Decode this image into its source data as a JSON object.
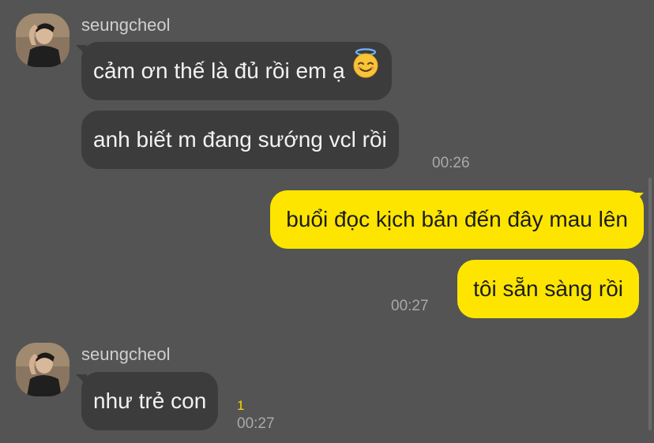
{
  "conversation": {
    "messages": [
      {
        "sender": "seungcheol",
        "text": "cảm ơn thế là đủ rồi em ạ",
        "emoji": "smiling-face-with-halo",
        "direction": "incoming"
      },
      {
        "text": "anh biết m đang sướng vcl rồi",
        "time": "00:26",
        "direction": "incoming"
      },
      {
        "text": "buổi đọc kịch bản đến đây mau lên",
        "direction": "outgoing"
      },
      {
        "text": "tôi sẵn sàng rồi",
        "time": "00:27",
        "direction": "outgoing"
      },
      {
        "sender": "seungcheol",
        "text": "như trẻ con",
        "unread": "1",
        "time": "00:27",
        "direction": "incoming"
      }
    ]
  },
  "colors": {
    "background": "#545454",
    "incoming_bubble": "#3c3c3c",
    "outgoing_bubble": "#fde500",
    "unread_count": "#f5d800"
  }
}
